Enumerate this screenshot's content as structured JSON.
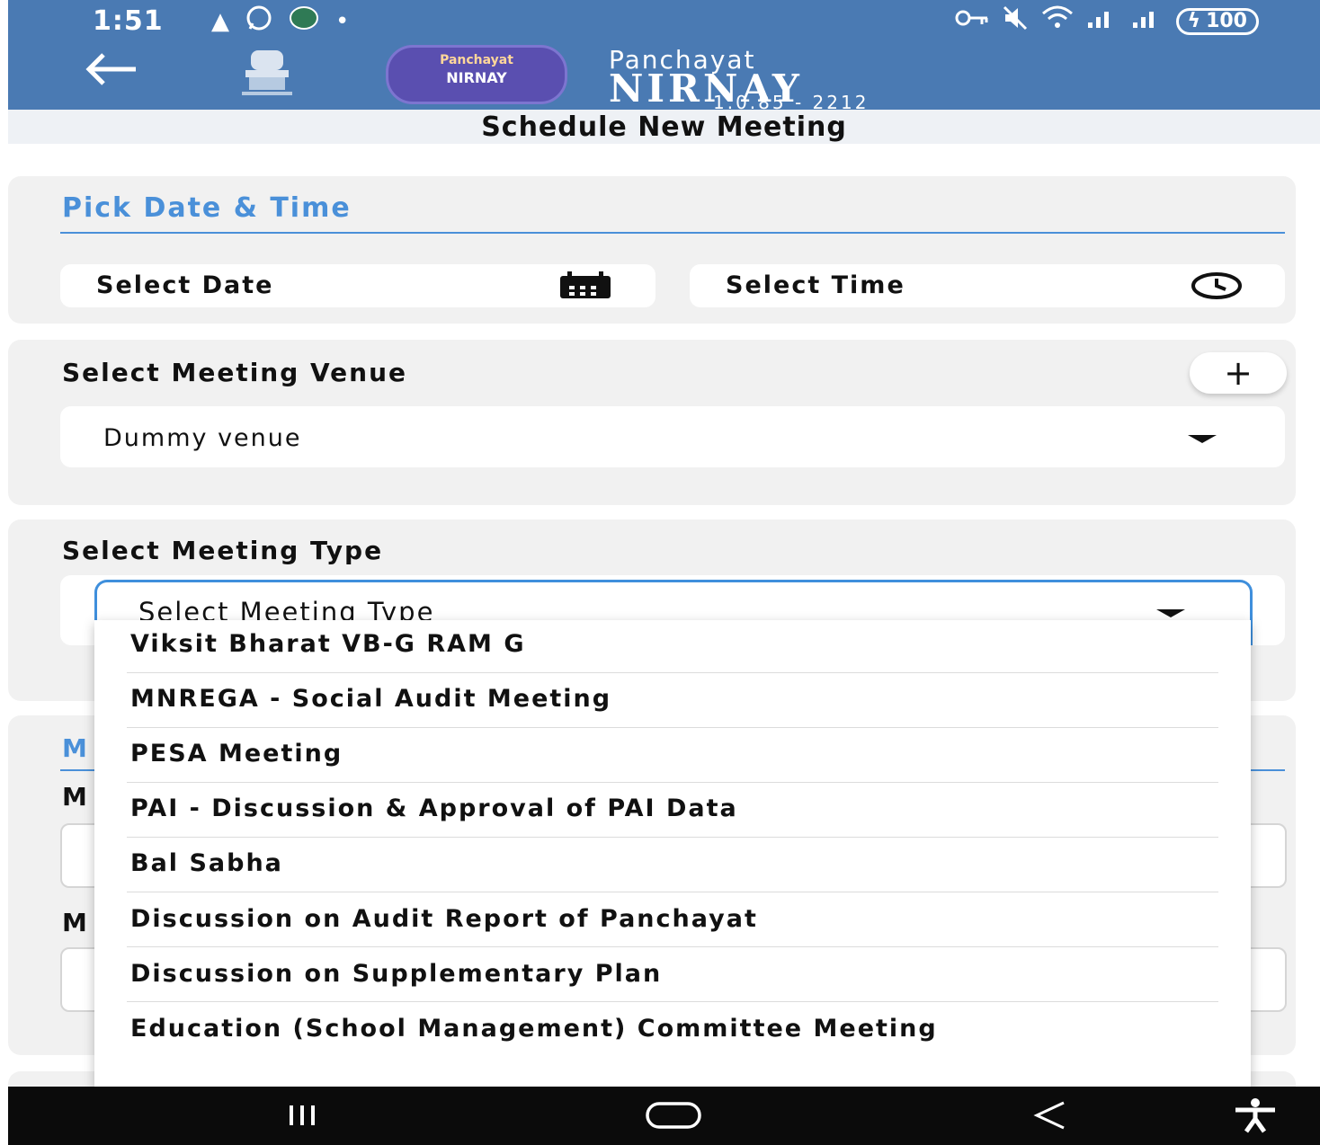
{
  "status_bar": {
    "time": "1:51",
    "battery": "100"
  },
  "app_header": {
    "logo_top_text": "Panchayat",
    "logo_bottom_text": "NIRNAY",
    "brand_subtitle": "Panchayat",
    "brand_title": "NIRNAY",
    "version": "1.0.85 - 2212"
  },
  "page": {
    "title": "Schedule New Meeting"
  },
  "date_time": {
    "heading": "Pick Date & Time",
    "date_label": "Select Date",
    "time_label": "Select Time"
  },
  "venue": {
    "heading": "Select Meeting Venue",
    "add_label": "+",
    "selected": "Dummy venue"
  },
  "meeting_type": {
    "heading": "Select Meeting Type",
    "placeholder": "Select Meeting Type",
    "options": [
      "Viksit Bharat VB-G RAM G",
      "MNREGA - Social Audit Meeting",
      "PESA Meeting",
      "PAI - Discussion & Approval of PAI Data",
      "Bal Sabha",
      "Discussion on Audit Report of Panchayat",
      "Discussion on Supplementary Plan",
      "Education (School Management) Committee Meeting"
    ]
  },
  "obscured_section": {
    "heading_fragment": "M",
    "label_1_fragment": "M",
    "label_2_fragment": "M"
  },
  "colors": {
    "header_bg": "#4a7ab3",
    "accent_blue": "#4a90d9",
    "card_bg": "#f1f1f1",
    "navbar_bg": "#0b0b0b"
  }
}
